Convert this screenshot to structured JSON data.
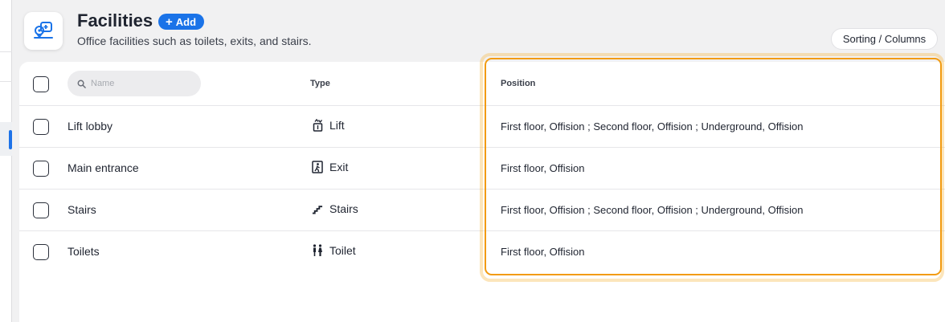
{
  "header": {
    "title": "Facilities",
    "add_label": "Add",
    "subtitle": "Office facilities such as toilets, exits, and stairs.",
    "sort_label": "Sorting / Columns"
  },
  "table": {
    "search_placeholder": "Name",
    "columns": {
      "type": "Type",
      "position": "Position"
    },
    "rows": [
      {
        "name": "Lift lobby",
        "type": "Lift",
        "type_icon": "lift-icon",
        "position": "First floor, Offision ; Second floor, Offision ; Underground, Offision"
      },
      {
        "name": "Main entrance",
        "type": "Exit",
        "type_icon": "exit-icon",
        "position": "First floor, Offision"
      },
      {
        "name": "Stairs",
        "type": "Stairs",
        "type_icon": "stairs-icon",
        "position": "First floor, Offision ; Second floor, Offision ; Underground, Offision"
      },
      {
        "name": "Toilets",
        "type": "Toilet",
        "type_icon": "toilet-icon",
        "position": "First floor, Offision"
      }
    ]
  },
  "colors": {
    "accent": "#1a73e8",
    "highlight": "#f29b11"
  }
}
